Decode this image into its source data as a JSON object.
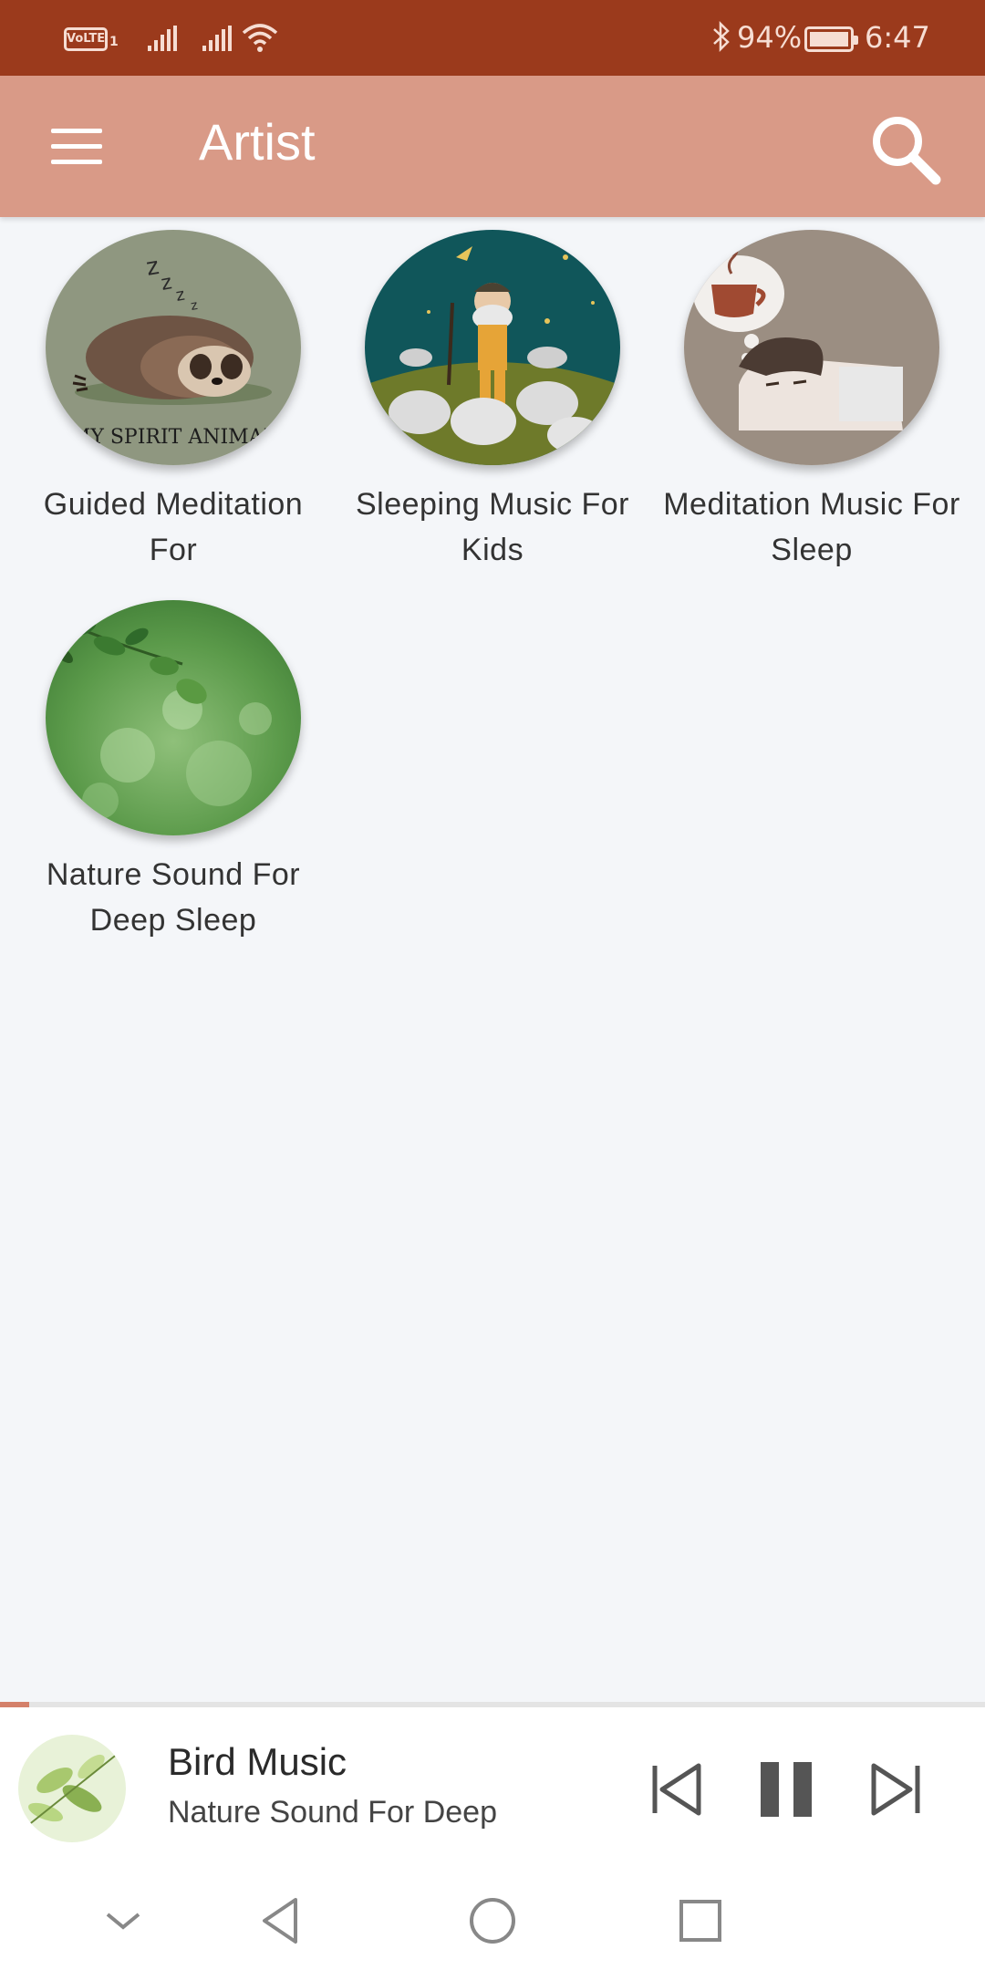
{
  "status_bar": {
    "volte": "VoLTE",
    "sim": "1",
    "battery_percent": "94%",
    "time": "6:47",
    "icons": [
      "signal-icon",
      "signal-icon",
      "wifi-icon",
      "bluetooth-icon",
      "battery-icon"
    ]
  },
  "app_bar": {
    "title": "Artist",
    "menu_icon": "hamburger-menu-icon",
    "search_icon": "search-icon",
    "color": "#d99a87"
  },
  "artists": [
    {
      "label": "Guided Meditation For",
      "image_caption": "MY SPIRIT ANIMAL"
    },
    {
      "label": "Sleeping Music For Kids"
    },
    {
      "label": "Meditation Music For Sleep"
    },
    {
      "label": "Nature Sound For Deep Sleep"
    }
  ],
  "now_playing": {
    "title": "Bird Music",
    "artist": "Nature Sound For Deep",
    "progress": 0.03,
    "controls": [
      "previous-icon",
      "pause-icon",
      "next-icon"
    ]
  },
  "nav_bar": {
    "icons": [
      "chevron-down-icon",
      "back-icon",
      "home-icon",
      "recents-icon"
    ]
  },
  "colors": {
    "status_bar": "#9b3a1c",
    "app_bar": "#d99a87",
    "background": "#f4f6f9",
    "progress_accent": "#d4806a"
  }
}
